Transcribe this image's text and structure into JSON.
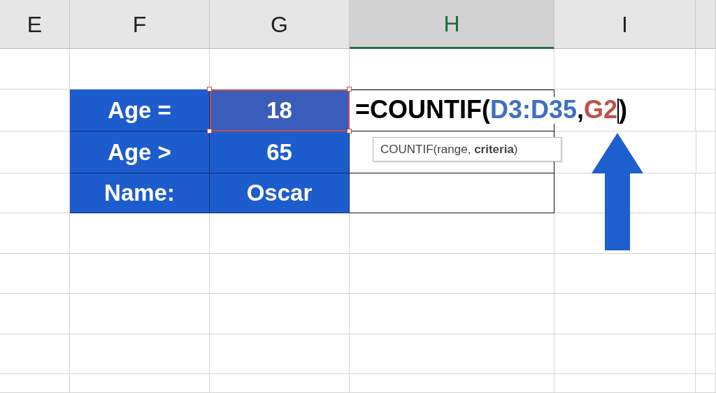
{
  "column_headers": [
    {
      "label": "E",
      "selected": false
    },
    {
      "label": "F",
      "selected": false
    },
    {
      "label": "G",
      "selected": false
    },
    {
      "label": "H",
      "selected": true
    },
    {
      "label": "I",
      "selected": false
    }
  ],
  "rows": [
    {
      "label": "Age =",
      "value": "18",
      "selected": true
    },
    {
      "label": "Age >",
      "value": "65",
      "selected": false
    },
    {
      "label": "Name:",
      "value": "Oscar",
      "selected": false
    }
  ],
  "formula": {
    "parts": [
      {
        "text": "=COUNTIF(",
        "color": "#000000"
      },
      {
        "text": "D3:D35",
        "color": "#3f6fc4"
      },
      {
        "text": ",",
        "color": "#000000"
      },
      {
        "text": "G2",
        "color": "#c0504d"
      },
      {
        "text": ")",
        "color": "#000000"
      }
    ]
  },
  "tooltip": "COUNTIF(range, **criteria**)"
}
